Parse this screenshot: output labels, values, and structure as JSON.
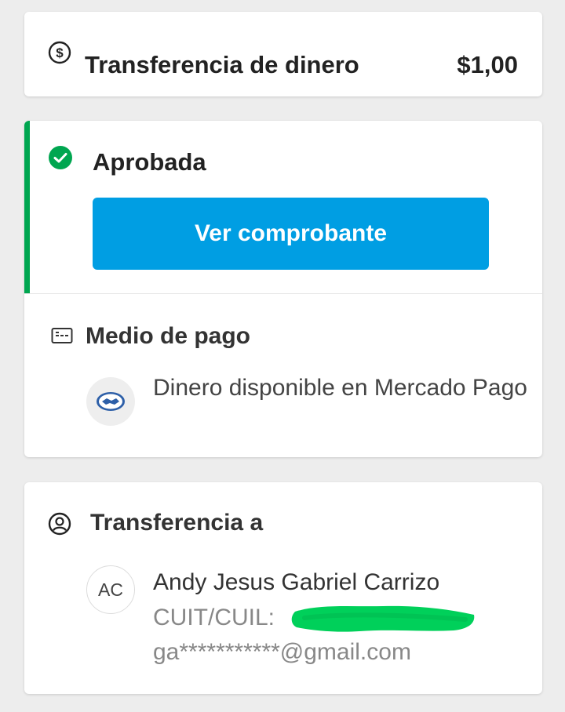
{
  "summary": {
    "icon": "dollar-circle-icon",
    "title": "Transferencia de dinero",
    "amount": "$1,00"
  },
  "status": {
    "icon": "check-circle-icon",
    "label": "Aprobada",
    "accent_color": "#00a650",
    "button_label": "Ver comprobante",
    "button_color": "#009ee3"
  },
  "payment_method": {
    "icon": "card-icon",
    "title": "Medio de pago",
    "logo": "mercado-pago-handshake-icon",
    "description": "Dinero disponible en Mercado Pago"
  },
  "recipient": {
    "icon": "user-circle-icon",
    "title": "Transferencia a",
    "avatar_initials": "AC",
    "name": "Andy Jesus Gabriel Carrizo",
    "cuit_label": "CUIT/CUIL:",
    "email": "ga***********@gmail.com"
  }
}
